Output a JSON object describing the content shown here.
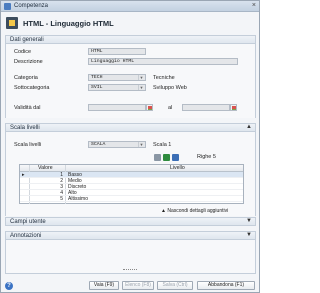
{
  "window": {
    "title": "Competenza",
    "close_glyph": "×",
    "header_title": "HTML - Linguaggio HTML"
  },
  "dati_generali": {
    "section_label": "Dati generali",
    "codice_label": "Codice",
    "codice_value": "HTML",
    "descrizione_label": "Descrizione",
    "descrizione_value": "Linguaggio HTML",
    "categoria_label": "Categoria",
    "categoria_value": "TECH",
    "categoria_desc": "Tecniche",
    "sottocategoria_label": "Sottocategoria",
    "sottocategoria_value": "SVIL",
    "sottocategoria_desc": "Sviluppo Web",
    "validita_label": "Validità dal",
    "al_label": "al"
  },
  "scala_livelli": {
    "section_label": "Scala livelli",
    "scala_label": "Scala livelli",
    "scala_value": "SCALA",
    "scala_desc": "Scala 1",
    "righe_label": "Righe 5",
    "columns": {
      "valore": "Valore",
      "livello": "Livello"
    },
    "rows": [
      {
        "valore": "1",
        "livello": "Basso"
      },
      {
        "valore": "2",
        "livello": "Medio"
      },
      {
        "valore": "3",
        "livello": "Discreto"
      },
      {
        "valore": "4",
        "livello": "Alto"
      },
      {
        "valore": "5",
        "livello": "Altissimo"
      }
    ],
    "nascondi_label": "Nascondi dettagli aggiuntivi"
  },
  "campi_utente": {
    "section_label": "Campi utente"
  },
  "annotazioni": {
    "section_label": "Annotazioni"
  },
  "footer": {
    "vaia_label": "Vaia (F9)",
    "elenco_label": "Elenco (F8)",
    "salva_label": "Salva (Ctrl)",
    "abbandona_label": "Abbandona (F1)",
    "help_glyph": "?"
  },
  "colors": {
    "accent": "#3b73c4",
    "toolbar_icon_green": "#2e8b3e",
    "toolbar_icon_blue": "#3c6fb6"
  }
}
